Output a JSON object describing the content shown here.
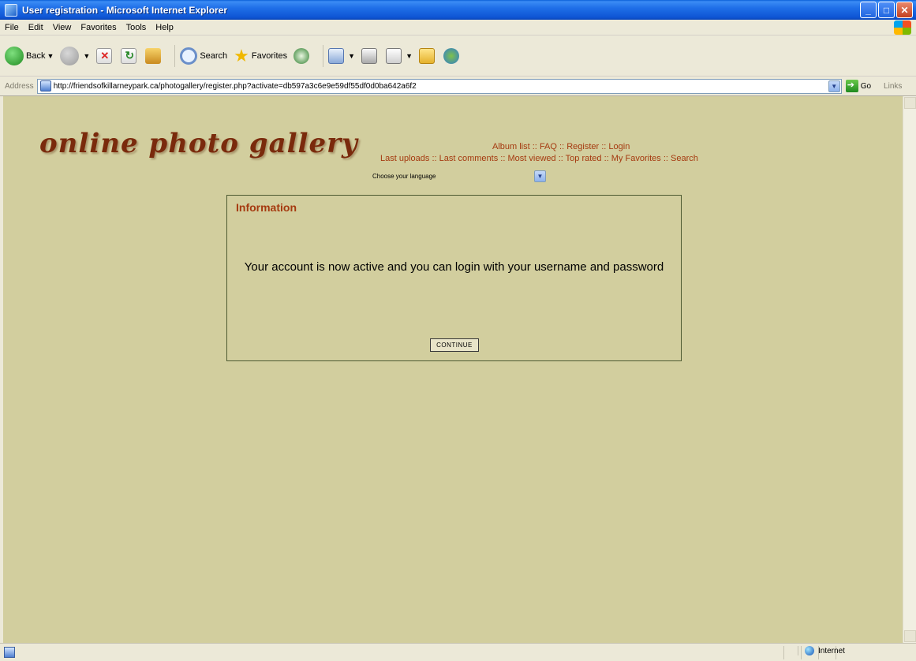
{
  "window": {
    "title": "User registration - Microsoft Internet Explorer"
  },
  "menubar": {
    "items": [
      "File",
      "Edit",
      "View",
      "Favorites",
      "Tools",
      "Help"
    ]
  },
  "toolbar": {
    "back_label": "Back",
    "search_label": "Search",
    "favorites_label": "Favorites"
  },
  "addressbar": {
    "label": "Address",
    "url": "http://friendsofkillarneypark.ca/photogallery/register.php?activate=db597a3c6e9e59df55df0d0ba642a6f2",
    "go_label": "Go",
    "links_label": "Links"
  },
  "page": {
    "logo_text": "online photo gallery",
    "nav_row1": [
      "Album list",
      "FAQ",
      "Register",
      "Login"
    ],
    "nav_row2": [
      "Last uploads",
      "Last comments",
      "Most viewed",
      "Top rated",
      "My Favorites",
      "Search"
    ],
    "nav_separator": "::",
    "language_select": "Choose your language",
    "info_title": "Information",
    "info_message": "Your account is now active and you can login with your username and password",
    "continue_label": "CONTINUE"
  },
  "statusbar": {
    "zone": "Internet"
  }
}
